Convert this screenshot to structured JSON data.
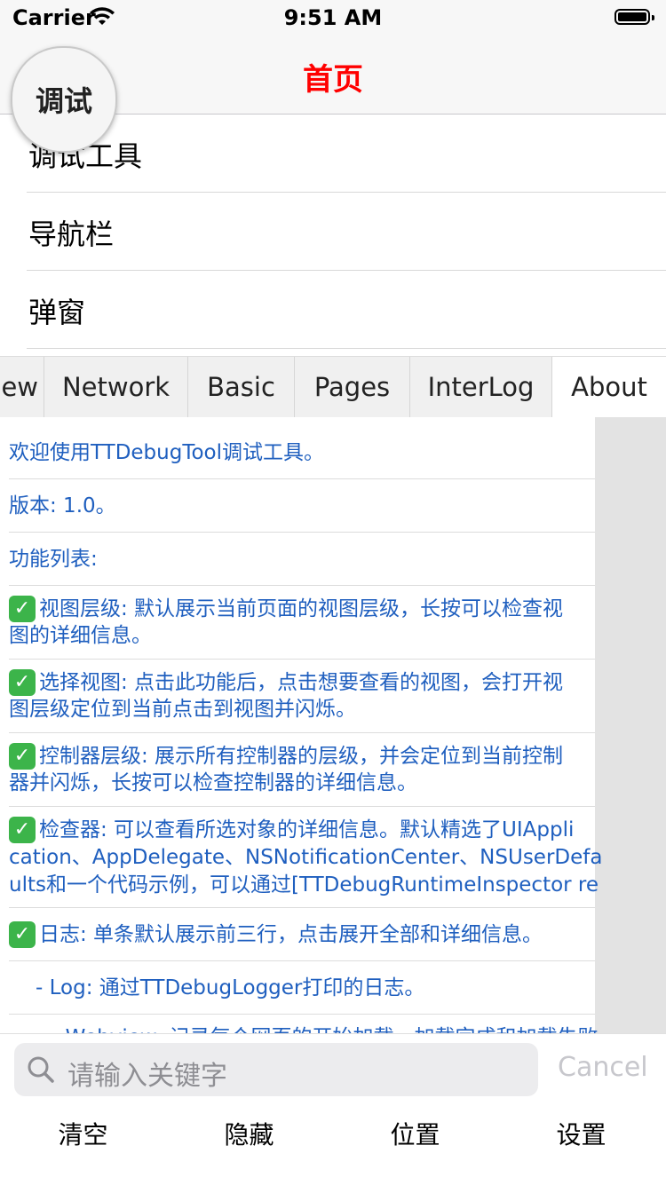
{
  "status_bar": {
    "carrier": "Carrier",
    "time": "9:51 AM"
  },
  "nav": {
    "title": "首页"
  },
  "debug_float": {
    "label": "调试"
  },
  "menu": [
    {
      "label": "调试工具"
    },
    {
      "label": "导航栏"
    },
    {
      "label": "弹窗"
    }
  ],
  "tabs": [
    {
      "label": "ew",
      "active": false
    },
    {
      "label": "Network",
      "active": false
    },
    {
      "label": "Basic",
      "active": false
    },
    {
      "label": "Pages",
      "active": false
    },
    {
      "label": "InterLog",
      "active": false
    },
    {
      "label": "About",
      "active": true
    }
  ],
  "about": {
    "welcome": "欢迎使用TTDebugTool调试工具。",
    "version": "版本: 1.0。",
    "feature_list": "功能列表:",
    "features": [
      {
        "lines": [
          "视图层级: 默认展示当前页面的视图层级，长按可以检查视",
          "图的详细信息。"
        ]
      },
      {
        "lines": [
          "选择视图: 点击此功能后，点击想要查看的视图，会打开视",
          "图层级定位到当前点击到视图并闪烁。"
        ]
      },
      {
        "lines": [
          "控制器层级: 展示所有控制器的层级，并会定位到当前控制",
          "器并闪烁，长按可以检查控制器的详细信息。"
        ]
      },
      {
        "lines": [
          "检查器: 可以查看所选对象的详细信息。默认精选了UIAppli",
          "cation、AppDelegate、NSNotificationCenter、NSUserDefa",
          "ults和一个代码示例，可以通过[TTDebugRuntimeInspector re"
        ]
      },
      {
        "lines": [
          "日志: 单条默认展示前三行，点击展开全部和详细信息。"
        ]
      }
    ],
    "log_item": "- Log: 通过TTDebugLogger打印的日志。",
    "cut_item": "- Webview: 记录每个网页的开始加载、加载完成和加载失败"
  },
  "search": {
    "placeholder": "请输入关键字",
    "cancel": "Cancel"
  },
  "bottom_buttons": [
    {
      "label": "清空"
    },
    {
      "label": "隐藏"
    },
    {
      "label": "位置"
    },
    {
      "label": "设置"
    }
  ],
  "icons": {
    "search": "search-icon",
    "wifi": "wifi-icon",
    "battery": "battery-icon",
    "check": "check-icon"
  },
  "colors": {
    "nav_title": "#ff0000",
    "link_text": "#1f5fbf",
    "check_bg": "#3cb44a"
  }
}
